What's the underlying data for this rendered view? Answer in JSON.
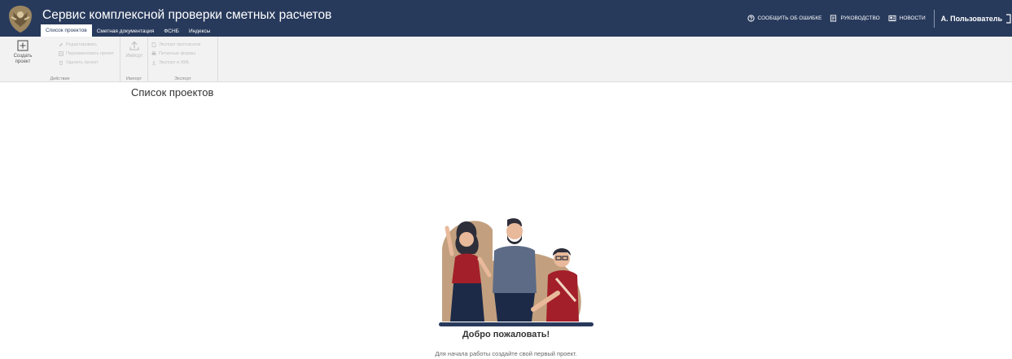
{
  "app": {
    "title": "Сервис комплексной проверки сметных расчетов"
  },
  "tabs": [
    {
      "label": "Список проектов",
      "active": true
    },
    {
      "label": "Сметная документация",
      "active": false
    },
    {
      "label": "ФСНБ",
      "active": false
    },
    {
      "label": "Индексы",
      "active": false
    }
  ],
  "header_links": {
    "report": {
      "label": "СООБЩИТЬ ОБ ОШИБКЕ",
      "icon": "help-circle-icon"
    },
    "guide": {
      "label": "РУКОВОДСТВО",
      "icon": "document-icon"
    },
    "news": {
      "label": "НОВОСТИ",
      "icon": "news-icon"
    }
  },
  "user": {
    "name": "А. Пользователь",
    "icon": "logout-icon"
  },
  "ribbon": {
    "actions": {
      "caption": "Действия",
      "create": "Создать проект",
      "edit": "Редактировать",
      "rename": "Переименовать проект",
      "delete": "Удалить проект"
    },
    "import": {
      "caption": "Импорт",
      "button": "Импорт"
    },
    "export": {
      "caption": "Экспорт",
      "protocols": "Экспорт протоколов",
      "print_forms": "Печатные формы",
      "xml": "Экспорт в XML"
    }
  },
  "page": {
    "title": "Список проектов"
  },
  "empty_state": {
    "heading": "Добро пожаловать!",
    "text": "Для начала работы создайте свой первый проект."
  },
  "colors": {
    "header_bg": "#283a5c",
    "ribbon_bg": "#f2f2f2",
    "accent_red": "#a31f2a"
  }
}
